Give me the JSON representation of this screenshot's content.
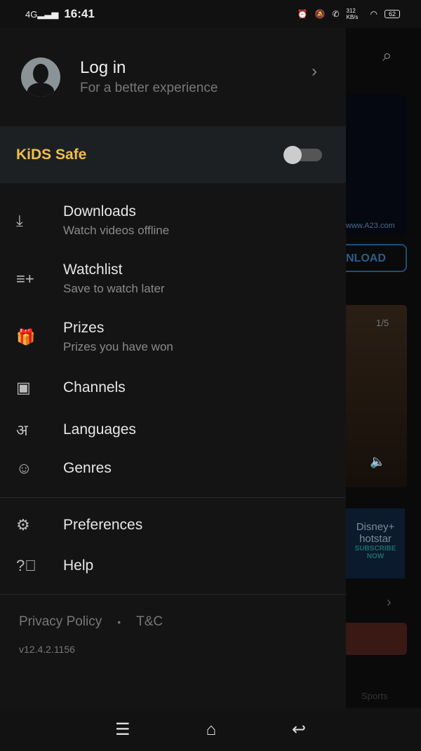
{
  "status": {
    "network": "4G",
    "time": "16:41",
    "speed": "312 KB/s",
    "battery": "62"
  },
  "background": {
    "url": "www.A23.com",
    "download": "NLOAD",
    "pager": "1/5",
    "ad_brand": "Disney+ hotstar",
    "ad_cta": "SUBSCRIBE NOW",
    "tab": "Sports"
  },
  "login": {
    "title": "Log in",
    "subtitle": "For a better experience"
  },
  "kids": {
    "label": "KiDS Safe",
    "enabled": false
  },
  "menu": [
    {
      "icon": "download-icon",
      "label": "Downloads",
      "sub": "Watch videos offline"
    },
    {
      "icon": "watchlist-add-icon",
      "label": "Watchlist",
      "sub": "Save to watch later"
    },
    {
      "icon": "gift-icon",
      "label": "Prizes",
      "sub": "Prizes you have won"
    },
    {
      "icon": "channels-icon",
      "label": "Channels"
    },
    {
      "icon": "languages-icon",
      "label": "Languages"
    },
    {
      "icon": "genres-masks-icon",
      "label": "Genres"
    }
  ],
  "settings": [
    {
      "icon": "gear-icon",
      "label": "Preferences"
    },
    {
      "icon": "help-icon",
      "label": "Help"
    }
  ],
  "footer": {
    "privacy": "Privacy Policy",
    "dot": "•",
    "terms": "T&C",
    "version": "v12.4.2.1156"
  }
}
